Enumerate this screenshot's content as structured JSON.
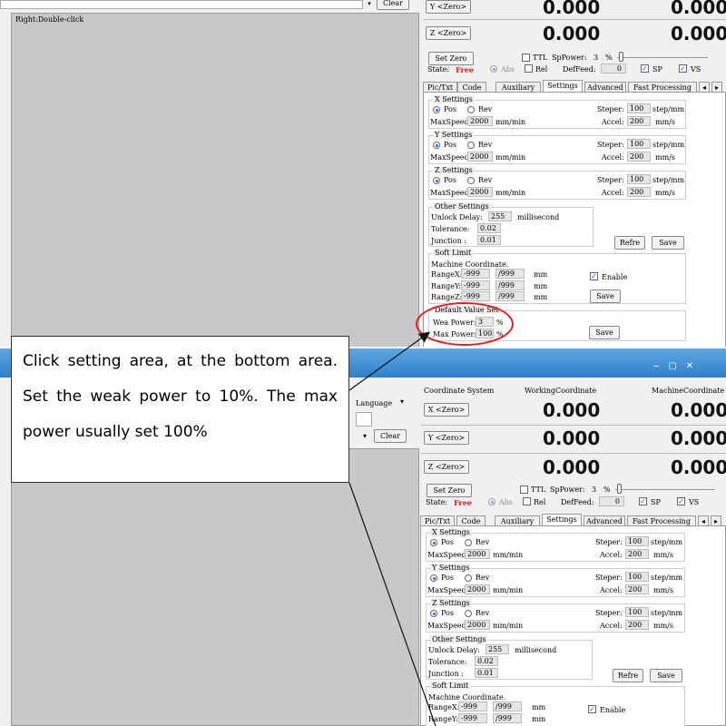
{
  "top": {
    "hint": "Right:Double-click",
    "clear_label": "Clear",
    "y_zero": "Y <Zero>",
    "z_zero": "Z <Zero>",
    "y_work": "0.000",
    "y_mach": "0.000",
    "z_work": "0.000",
    "z_mach": "0.000",
    "set_zero": "Set Zero",
    "ttl": "TTL",
    "sppower": "SpPower:",
    "sppower_val": "3",
    "percent": "%",
    "state_label": "State:",
    "state_val": "Free",
    "abs": "Abs",
    "rel": "Rel",
    "deffeed": "DefFeed:",
    "deffeed_val": "0",
    "sp": "SP",
    "vs": "VS",
    "tabs": [
      "Pic/Txt",
      "Code",
      "Auxiliary",
      "Settings",
      "Advanced",
      "Fast Processing"
    ],
    "x_settings": "X Settings",
    "y_settings": "Y Settings",
    "z_settings": "Z Settings",
    "pos": "Pos",
    "rev": "Rev",
    "steper": "Steper:",
    "steper_val": "100",
    "step_unit": "step/mm",
    "maxspeed": "MaxSpeed:",
    "maxspeed_val": "2000",
    "mm_min": "mm/min",
    "accel": "Accel:",
    "accel_val": "200",
    "mm_s": "mm/s",
    "other_settings": "Other Settings",
    "unlock_delay": "Unlock Delay:",
    "unlock_val": "255",
    "millisecond": "millisecond",
    "tolerance": "Tolerance:",
    "tolerance_val": "0.02",
    "junction": "Junction :",
    "junction_val": "0.01",
    "refre": "Refre",
    "save": "Save",
    "soft_limit": "Soft Limit",
    "machine_coord": "Machine Coordinate.",
    "rangex": "RangeX:",
    "rangex_a": "-999",
    "rangex_b": "/999",
    "rangey": "RangeY:",
    "rangey_a": "-999",
    "rangey_b": "/999",
    "rangez": "RangeZ:",
    "rangez_a": "-999",
    "rangez_b": "/999",
    "mm": "mm",
    "enable": "Enable",
    "default_value": "Default Value Set",
    "wea_power": "Wea Power:",
    "wea_val": "3",
    "max_power": "Max Power:",
    "max_val": "100"
  },
  "bottom": {
    "language": "Language",
    "clear_label": "Clear",
    "coord_system": "Coordinate System",
    "working": "WorkingCoordinate",
    "machine": "MachineCoordinate",
    "x_zero": "X <Zero>",
    "y_zero": "Y <Zero>",
    "z_zero": "Z <Zero>",
    "x_work": "0.000",
    "x_mach": "0.000",
    "y_work": "0.000",
    "y_mach": "0.000",
    "z_work": "0.000",
    "z_mach": "0.000"
  },
  "callout": {
    "text": "Click setting area, at the bottom area. Set the weak power to 10%. The max power usually set 100%"
  }
}
